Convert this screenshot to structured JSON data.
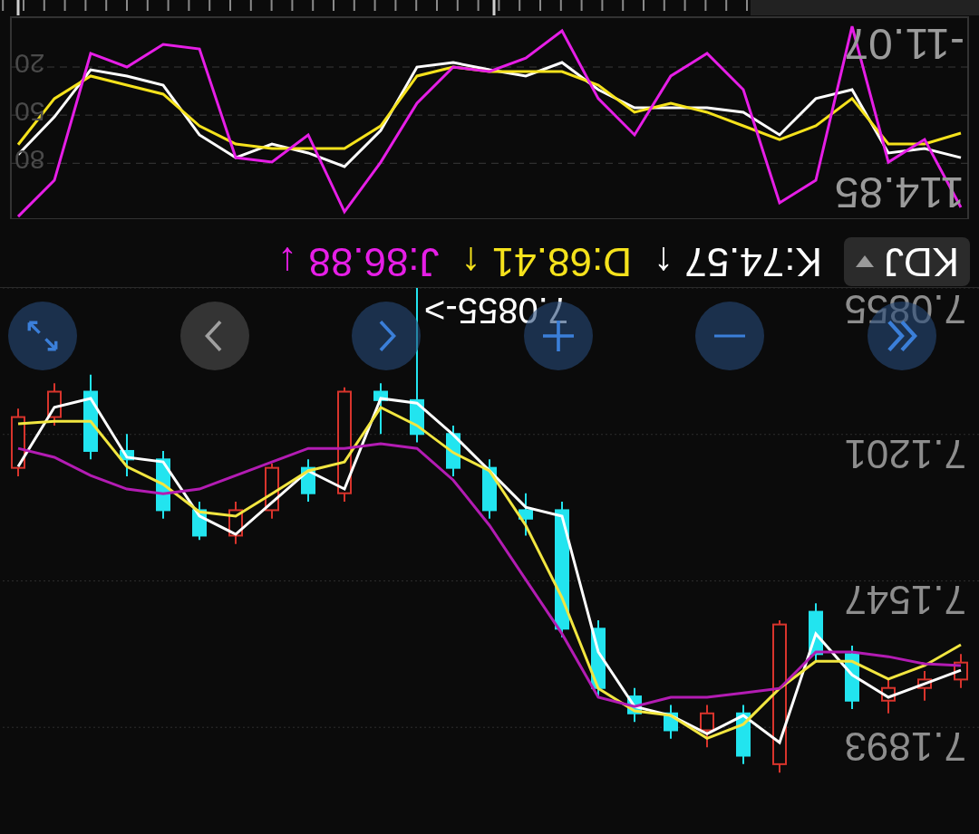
{
  "main_chart": {
    "controls": [
      {
        "kind": "rewind",
        "disabled": false
      },
      {
        "kind": "minus",
        "disabled": false
      },
      {
        "kind": "plus",
        "disabled": false
      },
      {
        "kind": "prev",
        "disabled": false
      },
      {
        "kind": "next",
        "disabled": true
      },
      {
        "kind": "expand",
        "disabled": false
      }
    ],
    "chart_data": {
      "type": "candlestick",
      "ylim": [
        7.2145,
        7.0855
      ],
      "grid": true,
      "yticks": [
        {
          "value": 7.1893,
          "label": "7.1893"
        },
        {
          "value": 7.1547,
          "label": "7.1547"
        },
        {
          "value": 7.1201,
          "label": "7.1201"
        },
        {
          "value": 7.0855,
          "label": "7.0855"
        }
      ],
      "annotations": [
        "7.0855->"
      ],
      "ohlc": [
        [
          7.116,
          7.13,
          7.114,
          7.128
        ],
        [
          7.11,
          7.118,
          7.108,
          7.116
        ],
        [
          7.124,
          7.126,
          7.106,
          7.11
        ],
        [
          7.126,
          7.13,
          7.12,
          7.124
        ],
        [
          7.138,
          7.14,
          7.124,
          7.126
        ],
        [
          7.144,
          7.145,
          7.136,
          7.138
        ],
        [
          7.138,
          7.146,
          7.136,
          7.144
        ],
        [
          7.128,
          7.14,
          7.127,
          7.138
        ],
        [
          7.134,
          7.136,
          7.126,
          7.128
        ],
        [
          7.11,
          7.136,
          7.109,
          7.134
        ],
        [
          7.112,
          7.12,
          7.108,
          7.11
        ],
        [
          7.12,
          7.122,
          7.0855,
          7.112
        ],
        [
          7.128,
          7.13,
          7.118,
          7.12
        ],
        [
          7.138,
          7.14,
          7.126,
          7.128
        ],
        [
          7.14,
          7.144,
          7.134,
          7.138
        ],
        [
          7.166,
          7.168,
          7.136,
          7.138
        ],
        [
          7.18,
          7.182,
          7.164,
          7.166
        ],
        [
          7.186,
          7.188,
          7.18,
          7.182
        ],
        [
          7.19,
          7.192,
          7.184,
          7.186
        ],
        [
          7.186,
          7.194,
          7.184,
          7.19
        ],
        [
          7.196,
          7.198,
          7.184,
          7.186
        ],
        [
          7.165,
          7.2,
          7.164,
          7.198
        ],
        [
          7.172,
          7.174,
          7.16,
          7.162
        ],
        [
          7.183,
          7.185,
          7.17,
          7.172
        ],
        [
          7.18,
          7.186,
          7.178,
          7.183
        ],
        [
          7.178,
          7.183,
          7.176,
          7.18
        ],
        [
          7.174,
          7.18,
          7.172,
          7.178
        ]
      ],
      "series": [
        {
          "type": "line",
          "color": "#ffffff",
          "values": [
            7.1277,
            7.1137,
            7.1116,
            7.1255,
            7.1266,
            7.1394,
            7.1437,
            7.1362,
            7.1287,
            7.133,
            7.1116,
            7.1127,
            7.1202,
            7.1287,
            7.1373,
            7.1394,
            7.1715,
            7.1844,
            7.1865,
            7.1908,
            7.1865,
            7.1929,
            7.1672,
            7.1769,
            7.1822,
            7.179,
            7.1758
          ]
        },
        {
          "type": "line",
          "color": "#f2e640",
          "values": [
            7.1176,
            7.117,
            7.117,
            7.1277,
            7.1319,
            7.1384,
            7.1394,
            7.1341,
            7.1287,
            7.1266,
            7.1137,
            7.118,
            7.1244,
            7.1287,
            7.1416,
            7.1587,
            7.1801,
            7.1854,
            7.1865,
            7.1919,
            7.1886,
            7.1801,
            7.1737,
            7.1737,
            7.1779,
            7.1747,
            7.1698
          ]
        },
        {
          "type": "line",
          "color": "#b31cb3",
          "values": [
            7.1234,
            7.1255,
            7.1298,
            7.133,
            7.1341,
            7.133,
            7.1298,
            7.1266,
            7.1234,
            7.1234,
            7.1223,
            7.1234,
            7.1309,
            7.1416,
            7.1544,
            7.1672,
            7.1822,
            7.1844,
            7.1822,
            7.1822,
            7.1812,
            7.1801,
            7.1715,
            7.1715,
            7.1726,
            7.1743,
            7.1747
          ]
        }
      ]
    }
  },
  "kdj": {
    "selector": {
      "label": "KDJ"
    },
    "readings": [
      {
        "text": "K:74.57",
        "arrow": "↑",
        "color": "#ffffff"
      },
      {
        "text": "D:68.41",
        "arrow": "↑",
        "color": "#f5e21c"
      },
      {
        "text": "J:86.88",
        "arrow": "↓",
        "color": "#e61ee6"
      }
    ],
    "range_high": "114.85",
    "range_low": "-11.07",
    "chart_data": {
      "type": "line",
      "ylim": [
        114.85,
        -11.07
      ],
      "grid": true,
      "yticks": [
        {
          "value": 80,
          "label": "80"
        },
        {
          "value": 50,
          "label": "50"
        },
        {
          "value": 20,
          "label": "20"
        }
      ],
      "series": [
        {
          "color": "#ffffff",
          "values": [
            74.57,
            51.1,
            21.7,
            25.6,
            31.3,
            62.3,
            76.5,
            68.0,
            73.6,
            82.1,
            59.5,
            20.0,
            17.2,
            21.7,
            25.6,
            17.2,
            34.1,
            45.4,
            45.4,
            45.4,
            48.2,
            62.3,
            39.7,
            34.1,
            73.6,
            70.8,
            76.5
          ]
        },
        {
          "color": "#f5e21c",
          "values": [
            68.41,
            39.7,
            25.6,
            31.3,
            36.9,
            56.7,
            68.0,
            70.8,
            70.8,
            70.8,
            56.7,
            25.6,
            20.0,
            22.8,
            22.8,
            22.8,
            31.3,
            48.2,
            42.6,
            48.2,
            56.7,
            65.2,
            56.7,
            39.7,
            68.0,
            68.0,
            61.2
          ]
        },
        {
          "color": "#e61ee6",
          "values": [
            113.2,
            90.6,
            11.5,
            20.0,
            5.9,
            8.7,
            76.5,
            79.3,
            62.3,
            110.3,
            79.3,
            42.6,
            20.0,
            22.8,
            14.4,
            -2.6,
            39.7,
            62.3,
            25.6,
            11.5,
            34.1,
            104.7,
            90.6,
            -5.4,
            79.3,
            65.2,
            107.5
          ]
        }
      ]
    }
  }
}
